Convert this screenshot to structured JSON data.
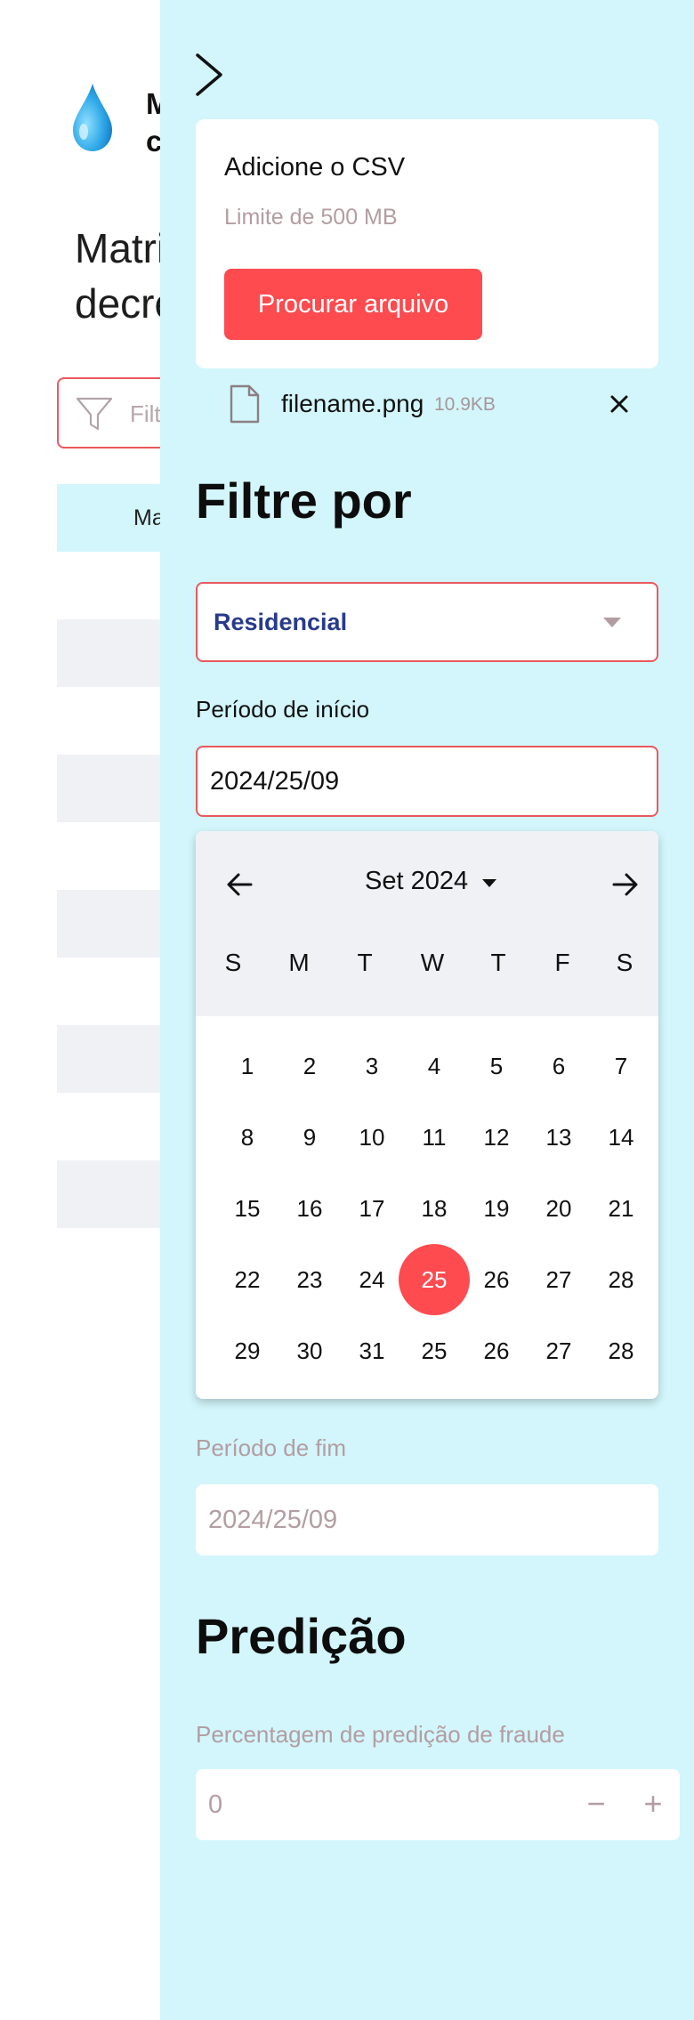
{
  "background": {
    "brand_line1": "M",
    "brand_line2": "c",
    "title_line1": "Matri",
    "title_line2": "decre",
    "filter_placeholder": "Filt",
    "table_header_first": "Ma"
  },
  "upload": {
    "title": "Adicione o CSV",
    "limit": "Limite de 500 MB",
    "browse_label": "Procurar arquivo",
    "file_name": "filename.png",
    "file_size": "10.9KB"
  },
  "filters": {
    "heading": "Filtre por",
    "type_select": "Residencial",
    "start_label": "Período de início",
    "start_value": "2024/25/09",
    "end_label": "Período de fim",
    "end_value": "2024/25/09"
  },
  "calendar": {
    "month_label": "Set 2024",
    "weekdays": [
      "S",
      "M",
      "T",
      "W",
      "T",
      "F",
      "S"
    ],
    "weeks": [
      [
        "1",
        "2",
        "3",
        "4",
        "5",
        "6",
        "7"
      ],
      [
        "8",
        "9",
        "10",
        "11",
        "12",
        "13",
        "14"
      ],
      [
        "15",
        "16",
        "17",
        "18",
        "19",
        "20",
        "21"
      ],
      [
        "22",
        "23",
        "24",
        "25",
        "26",
        "27",
        "28"
      ],
      [
        "29",
        "30",
        "31",
        "25",
        "26",
        "27",
        "28"
      ]
    ],
    "selected_day": "25"
  },
  "prediction": {
    "heading": "Predição",
    "percent_label": "Percentagem de predição de fraude",
    "percent_value": "0",
    "minus_label": "−",
    "plus_label": "+"
  },
  "colors": {
    "accent": "#fd4b4f",
    "drawer_bg": "#d2f6fb",
    "select_text": "#283a8b"
  },
  "icons": {
    "logo": "water-drop-icon",
    "close_drawer": "chevron-right-icon",
    "file": "file-icon",
    "remove": "close-icon",
    "filter": "filter-icon",
    "prev_month": "arrow-left-icon",
    "next_month": "arrow-right-icon"
  }
}
